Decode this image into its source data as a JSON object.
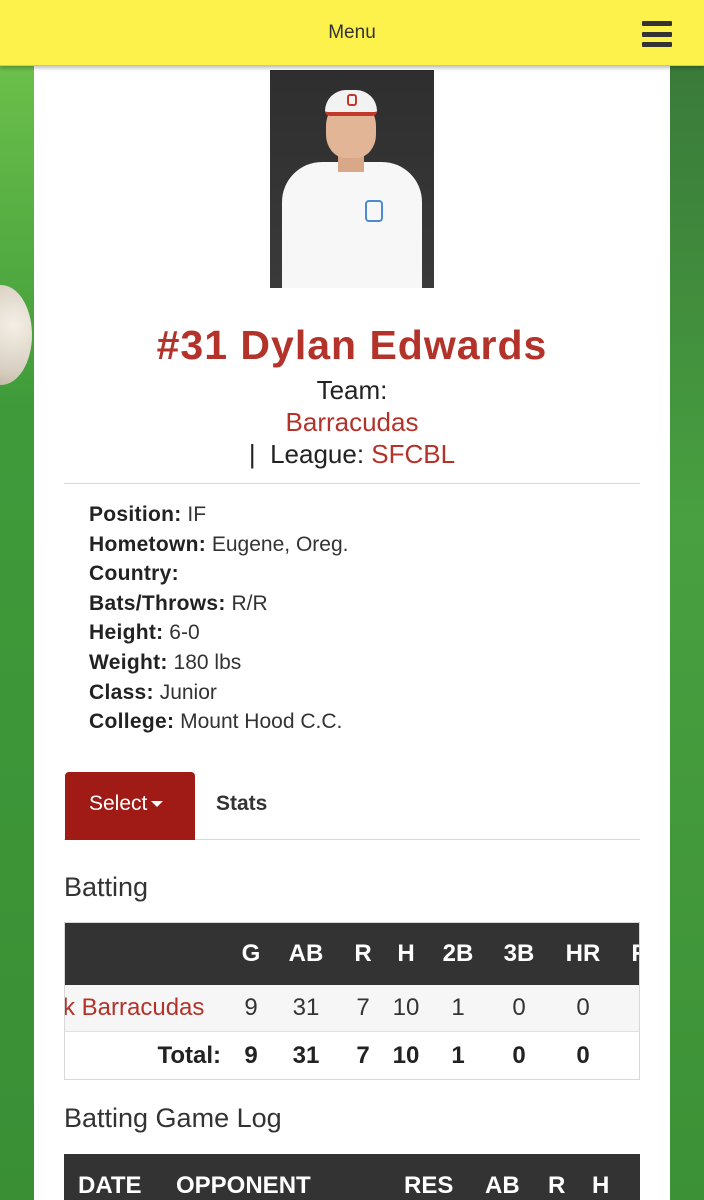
{
  "topbar": {
    "menu_label": "Menu"
  },
  "player": {
    "name": "#31 Dylan Edwards",
    "team_label": "Team:",
    "team_name": "Barracudas",
    "league_prefix": "|  League: ",
    "league_name": "SFCBL"
  },
  "bio": [
    {
      "label": "Position:",
      "value": "IF"
    },
    {
      "label": "Hometown:",
      "value": "Eugene, Oreg."
    },
    {
      "label": "Country:",
      "value": ""
    },
    {
      "label": "Bats/Throws:",
      "value": "R/R"
    },
    {
      "label": "Height:",
      "value": "6-0"
    },
    {
      "label": "Weight:",
      "value": "180 lbs"
    },
    {
      "label": "Class:",
      "value": "Junior"
    },
    {
      "label": "College:",
      "value": "Mount Hood C.C."
    }
  ],
  "tabs": {
    "select_label": "Select",
    "stats_label": "Stats"
  },
  "batting": {
    "title": "Batting",
    "headers": [
      "G",
      "AB",
      "R",
      "H",
      "2B",
      "3B",
      "HR",
      "R"
    ],
    "row": {
      "team": "rk Barracudas",
      "values": [
        "9",
        "31",
        "7",
        "10",
        "1",
        "0",
        "0"
      ]
    },
    "total": {
      "label": "Total:",
      "values": [
        "9",
        "31",
        "7",
        "10",
        "1",
        "0",
        "0"
      ]
    }
  },
  "game_log": {
    "title": "Batting Game Log",
    "headers": [
      "DATE",
      "OPPONENT",
      "RES",
      "AB",
      "R",
      "H"
    ]
  }
}
